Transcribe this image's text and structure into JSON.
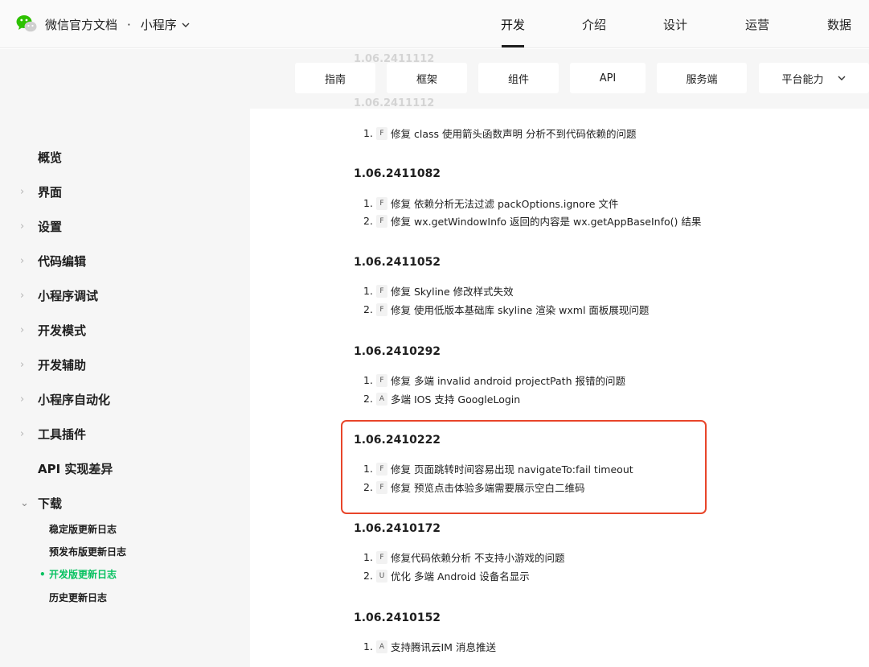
{
  "header": {
    "brand": "微信官方文档",
    "separator": "·",
    "product": "小程序",
    "nav": [
      "开发",
      "介绍",
      "设计",
      "运营",
      "数据"
    ]
  },
  "tabs": [
    "指南",
    "框架",
    "组件",
    "API",
    "服务端",
    "平台能力"
  ],
  "ghost_text": {
    "version_top": "1.06.2411112",
    "version_mid": "1.06.2411112"
  },
  "sidebar": {
    "items": [
      {
        "label": "概览",
        "arrow": ""
      },
      {
        "label": "界面",
        "arrow": "›"
      },
      {
        "label": "设置",
        "arrow": "›"
      },
      {
        "label": "代码编辑",
        "arrow": "›"
      },
      {
        "label": "小程序调试",
        "arrow": "›"
      },
      {
        "label": "开发模式",
        "arrow": "›"
      },
      {
        "label": "开发辅助",
        "arrow": "›"
      },
      {
        "label": "小程序自动化",
        "arrow": "›"
      },
      {
        "label": "工具插件",
        "arrow": "›"
      },
      {
        "label": "API 实现差异",
        "arrow": ""
      },
      {
        "label": "下载",
        "arrow": "⌄"
      }
    ],
    "sub_items": [
      {
        "label": "稳定版更新日志",
        "active": false
      },
      {
        "label": "预发布版更新日志",
        "active": false
      },
      {
        "label": "开发版更新日志",
        "active": true
      },
      {
        "label": "历史更新日志",
        "active": false
      }
    ],
    "active_bullet": "•"
  },
  "changelog": {
    "top_entry": {
      "num": "1.",
      "tag": "F",
      "text": "修复 class 使用箭头函数声明 分析不到代码依赖的问题"
    },
    "releases": [
      {
        "version": "1.06.2411082",
        "entries": [
          {
            "num": "1.",
            "tag": "F",
            "text": "修复 依赖分析无法过滤 packOptions.ignore 文件"
          },
          {
            "num": "2.",
            "tag": "F",
            "text": "修复 wx.getWindowInfo 返回的内容是 wx.getAppBaseInfo() 结果"
          }
        ]
      },
      {
        "version": "1.06.2411052",
        "entries": [
          {
            "num": "1.",
            "tag": "F",
            "text": "修复 Skyline 修改样式失效"
          },
          {
            "num": "2.",
            "tag": "F",
            "text": "修复 使用低版本基础库 skyline 渲染 wxml 面板展现问题"
          }
        ]
      },
      {
        "version": "1.06.2410292",
        "entries": [
          {
            "num": "1.",
            "tag": "F",
            "text": "修复 多端 invalid android projectPath 报错的问题"
          },
          {
            "num": "2.",
            "tag": "A",
            "text": "多端 IOS 支持 GoogleLogin"
          }
        ]
      },
      {
        "version": "1.06.2410222",
        "entries": [
          {
            "num": "1.",
            "tag": "F",
            "text": "修复 页面跳转时间容易出现 navigateTo:fail timeout"
          },
          {
            "num": "2.",
            "tag": "F",
            "text": "修复 预览点击体验多端需要展示空白二维码"
          }
        ]
      },
      {
        "version": "1.06.2410172",
        "entries": [
          {
            "num": "1.",
            "tag": "F",
            "text": "修复代码依赖分析 不支持小游戏的问题"
          },
          {
            "num": "2.",
            "tag": "U",
            "text": "优化 多端 Android 设备名显示"
          }
        ]
      },
      {
        "version": "1.06.2410152",
        "entries": [
          {
            "num": "1.",
            "tag": "A",
            "text": "支持腾讯云IM 消息推送"
          }
        ]
      }
    ]
  },
  "colors": {
    "accent": "#07c160",
    "highlight_border": "#e8452a"
  }
}
